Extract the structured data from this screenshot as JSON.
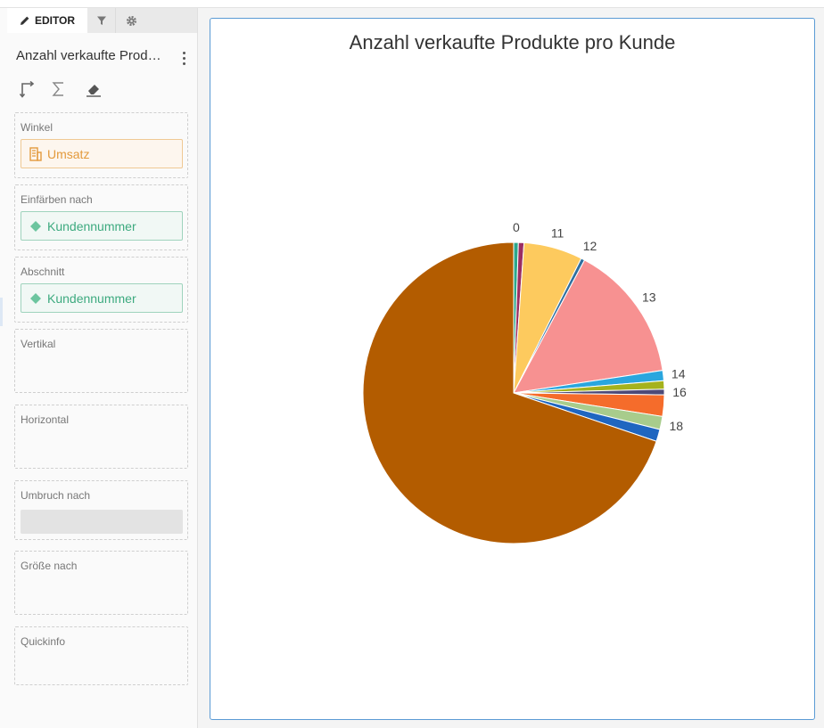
{
  "sidebar": {
    "tabs": [
      {
        "label": "EDITOR",
        "icon": "pencil-icon"
      },
      {
        "label": "",
        "icon": "filter-icon"
      },
      {
        "label": "",
        "icon": "gear-icon"
      }
    ],
    "title": "Anzahl verkaufte Produkte pro Kunde",
    "toolbar": [
      "swap-axes-icon",
      "sigma-icon",
      "eraser-icon"
    ],
    "wells": {
      "winkel": {
        "label": "Winkel",
        "field": "Umsatz"
      },
      "einfaerben": {
        "label": "Einfärben nach",
        "field": "Kundennummer"
      },
      "abschnitt": {
        "label": "Abschnitt",
        "field": "Kundennummer"
      },
      "vertikal": {
        "label": "Vertikal"
      },
      "horizontal": {
        "label": "Horizontal"
      },
      "umbruch": {
        "label": "Umbruch nach"
      },
      "groesse": {
        "label": "Größe nach"
      },
      "quickinfo": {
        "label": "Quickinfo"
      }
    }
  },
  "chart_data": {
    "type": "pie",
    "title": "Anzahl verkaufte Produkte pro Kunde",
    "slices": [
      {
        "label": "0",
        "value": 0.5,
        "color": "#2ca88c"
      },
      {
        "label": "",
        "value": 0.6,
        "color": "#9b2d62"
      },
      {
        "label": "11",
        "value": 6.3,
        "color": "#fdca5e"
      },
      {
        "label": "12",
        "value": 0.4,
        "color": "#2f6f9f"
      },
      {
        "label": "13",
        "value": 14.8,
        "color": "#f79191"
      },
      {
        "label": "14",
        "value": 1.1,
        "color": "#2aa6de"
      },
      {
        "label": "",
        "value": 0.9,
        "color": "#a5b21d"
      },
      {
        "label": "16",
        "value": 0.6,
        "color": "#4d4a78"
      },
      {
        "label": "",
        "value": 2.3,
        "color": "#f56c2b"
      },
      {
        "label": "18",
        "value": 1.4,
        "color": "#a8cc8c"
      },
      {
        "label": "",
        "value": 1.3,
        "color": "#1f66c0"
      },
      {
        "label": "",
        "value": 69.8,
        "color": "#b35c00"
      }
    ]
  }
}
